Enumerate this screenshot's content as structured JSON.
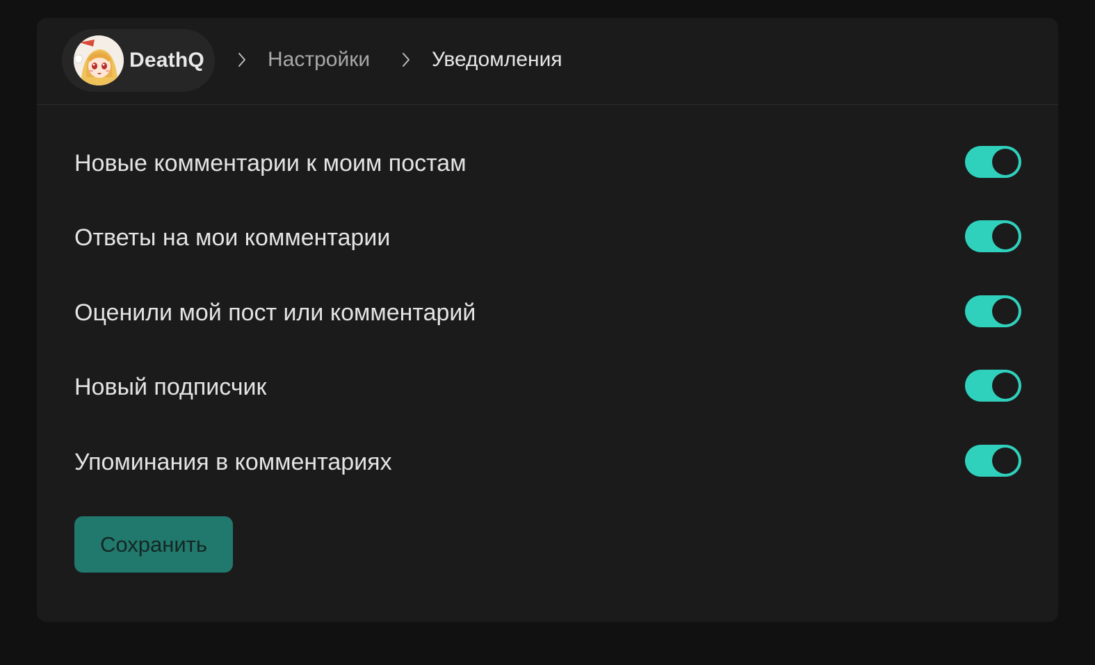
{
  "user": {
    "name": "DeathQ",
    "avatar_icon": "anime-girl-avatar"
  },
  "breadcrumb": {
    "separator_icon": "chevron-right-icon",
    "settings": "Настройки",
    "current": "Уведомления"
  },
  "settings": [
    {
      "label": "Новые комментарии к моим постам",
      "enabled": true
    },
    {
      "label": "Ответы на мои комментарии",
      "enabled": true
    },
    {
      "label": "Оценили мой пост или комментарий",
      "enabled": true
    },
    {
      "label": "Новый подписчик",
      "enabled": true
    },
    {
      "label": "Упоминания в комментариях",
      "enabled": true
    }
  ],
  "actions": {
    "save_label": "Сохранить"
  },
  "colors": {
    "accent": "#2fd1bd",
    "save_button": "#21786d",
    "card_background": "#1b1b1b",
    "page_background": "#111112"
  }
}
